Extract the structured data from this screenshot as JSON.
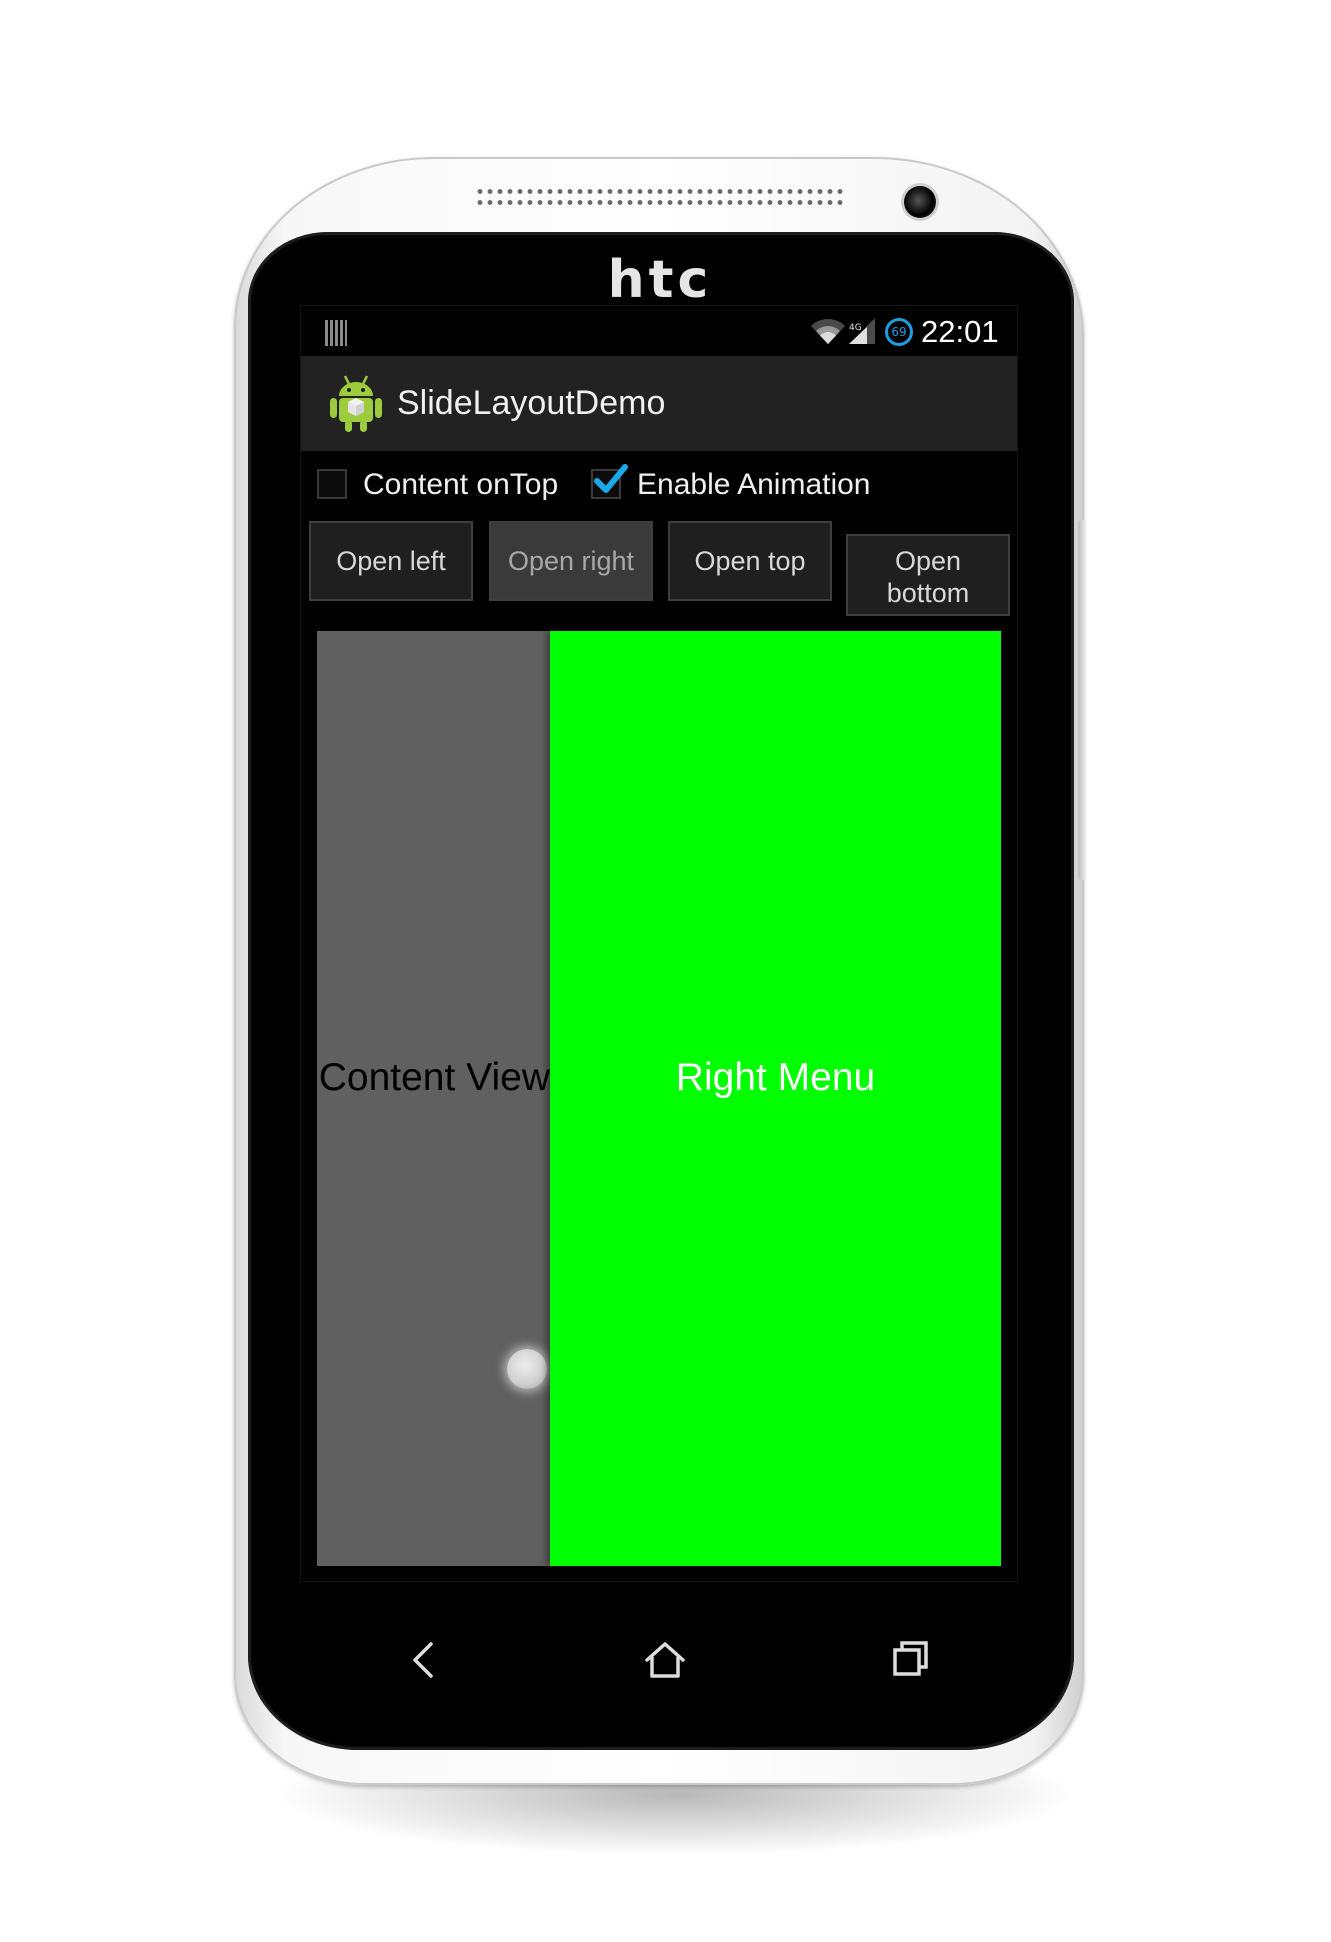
{
  "device": {
    "brand": "htc"
  },
  "status_bar": {
    "time": "22:01",
    "battery_level": "69",
    "icons": [
      "notification-icon",
      "wifi-icon",
      "signal-icon",
      "battery-icon"
    ]
  },
  "action_bar": {
    "title": "SlideLayoutDemo",
    "icon": "android-app-icon"
  },
  "options": [
    {
      "label": "Content onTop",
      "checked": false
    },
    {
      "label": "Enable Animation",
      "checked": true
    }
  ],
  "buttons": [
    {
      "label": "Open left",
      "pressed": false
    },
    {
      "label": "Open right",
      "pressed": true
    },
    {
      "label": "Open top",
      "pressed": false
    },
    {
      "label": "Open bottom",
      "pressed": false
    }
  ],
  "slide_layout": {
    "content_label": "Content View",
    "menu_label": "Right Menu",
    "menu_color": "#00ff00",
    "content_color": "#606060"
  },
  "nav_bar": {
    "items": [
      "back-icon",
      "home-icon",
      "recents-icon"
    ]
  }
}
